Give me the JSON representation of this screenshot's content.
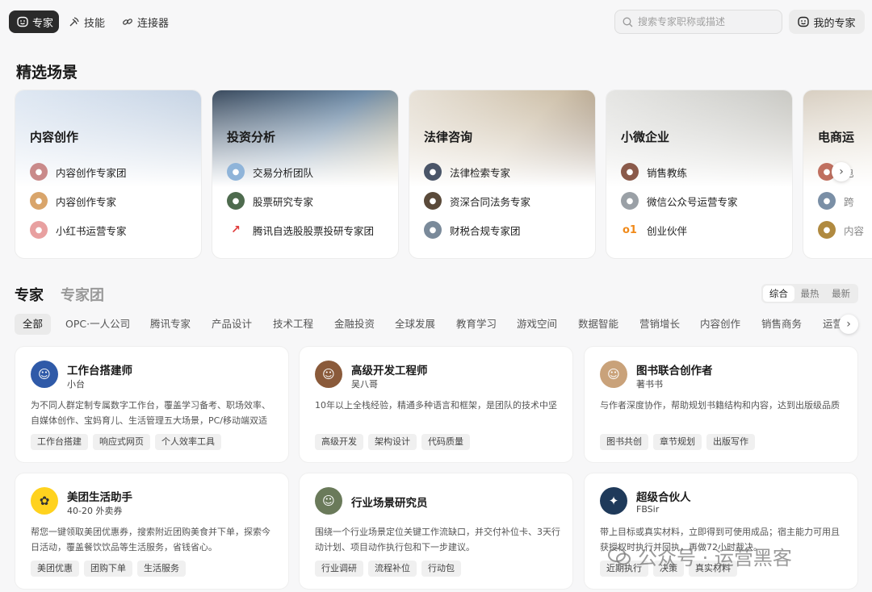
{
  "topbar": {
    "tabs": [
      {
        "label": "专家",
        "icon": "smile-face-icon",
        "active": true
      },
      {
        "label": "技能",
        "icon": "skill-wand-icon",
        "active": false
      },
      {
        "label": "连接器",
        "icon": "link-icon",
        "active": false
      }
    ],
    "search_placeholder": "搜索专家职称或描述",
    "my_experts_label": "我的专家"
  },
  "featured": {
    "title": "精选场景",
    "cards": [
      {
        "title": "内容创作",
        "items": [
          {
            "name": "内容创作专家团",
            "avatar_color": "#c98a8a"
          },
          {
            "name": "内容创作专家",
            "avatar_color": "#d9a56b"
          },
          {
            "name": "小红书运营专家",
            "avatar_color": "#e8a0a0"
          }
        ]
      },
      {
        "title": "投资分析",
        "items": [
          {
            "name": "交易分析团队",
            "avatar_color": "#8fb4d9"
          },
          {
            "name": "股票研究专家",
            "avatar_color": "#4e6b4e"
          },
          {
            "name": "腾讯自选股股票投研专家团",
            "avatar_color": "#e03a3a"
          }
        ]
      },
      {
        "title": "法律咨询",
        "items": [
          {
            "name": "法律检索专家",
            "avatar_color": "#4a5568"
          },
          {
            "name": "资深合同法务专家",
            "avatar_color": "#5a4a3a"
          },
          {
            "name": "财税合规专家团",
            "avatar_color": "#7a8a9a"
          }
        ]
      },
      {
        "title": "小微企业",
        "items": [
          {
            "name": "销售教练",
            "avatar_color": "#8a5a4a"
          },
          {
            "name": "微信公众号运营专家",
            "avatar_color": "#9aa0a6"
          },
          {
            "name": "创业伙伴",
            "avatar_color": "#f08a1a"
          }
        ]
      },
      {
        "title": "电商运",
        "items": [
          {
            "name": "电",
            "avatar_color": "#c07060"
          },
          {
            "name": "跨",
            "avatar_color": "#7a8fa6"
          },
          {
            "name": "内容",
            "avatar_color": "#b08a40"
          }
        ]
      }
    ]
  },
  "experts": {
    "tab_active": "专家",
    "tab_inactive": "专家团",
    "sort": [
      "综合",
      "最热",
      "最新"
    ],
    "categories": [
      "全部",
      "OPC·一人公司",
      "腾讯专家",
      "产品设计",
      "技术工程",
      "金融投资",
      "全球发展",
      "教育学习",
      "游戏空间",
      "数据智能",
      "营销增长",
      "内容创作",
      "销售商务",
      "运营"
    ],
    "cards": [
      {
        "name": "工作台搭建师",
        "author": "小台",
        "avatar": "person-blue-icon",
        "avatar_color": "#2f5aa8",
        "desc": "为不同人群定制专属数字工作台，覆盖学习备考、职场效率、自媒体创作、宝妈育儿、生活管理五大场景，PC/移动端双适配，一...",
        "tags": [
          "工作台搭建",
          "响应式网页",
          "个人效率工具"
        ]
      },
      {
        "name": "高级开发工程师",
        "author": "吴八哥",
        "avatar": "person-beard-icon",
        "avatar_color": "#8a5a3a",
        "desc": "10年以上全栈经验，精通多种语言和框架，是团队的技术中坚",
        "tags": [
          "高级开发",
          "架构设计",
          "代码质量"
        ]
      },
      {
        "name": "图书联合创作者",
        "author": "著书书",
        "avatar": "person-glasses-icon",
        "avatar_color": "#c9a27a",
        "desc": "与作者深度协作，帮助规划书籍结构和内容，达到出版级品质",
        "tags": [
          "图书共创",
          "章节规划",
          "出版写作"
        ]
      },
      {
        "name": "美团生活助手",
        "author": "40-20 外卖券",
        "avatar": "kangaroo-mascot-icon",
        "avatar_color": "#ffd21e",
        "desc": "帮您一键领取美团优惠券，搜索附近团购美食并下单，探索今日活动，覆盖餐饮饮品等生活服务，省钱省心。",
        "tags": [
          "美团优惠",
          "团购下单",
          "生活服务"
        ]
      },
      {
        "name": "行业场景研究员",
        "author": "",
        "avatar": "person-researcher-icon",
        "avatar_color": "#6a7a5a",
        "desc": "围绕一个行业场景定位关键工作流缺口，并交付补位卡、3天行动计划、项目动作执行包和下一步建议。",
        "tags": [
          "行业调研",
          "流程补位",
          "行动包"
        ]
      },
      {
        "name": "超级合伙人",
        "author": "FBSir",
        "avatar": "constellation-icon",
        "avatar_color": "#1f3a5a",
        "desc": "带上目标或真实材料，立即得到可使用成品；宿主能力可用且获授权时执行并回执，再做72小时裁决。",
        "tags": [
          "近期执行",
          "决策",
          "真实材料"
        ]
      }
    ]
  },
  "watermark": {
    "label": "公众号 · 运营黑客",
    "icon": "wechat-icon"
  }
}
